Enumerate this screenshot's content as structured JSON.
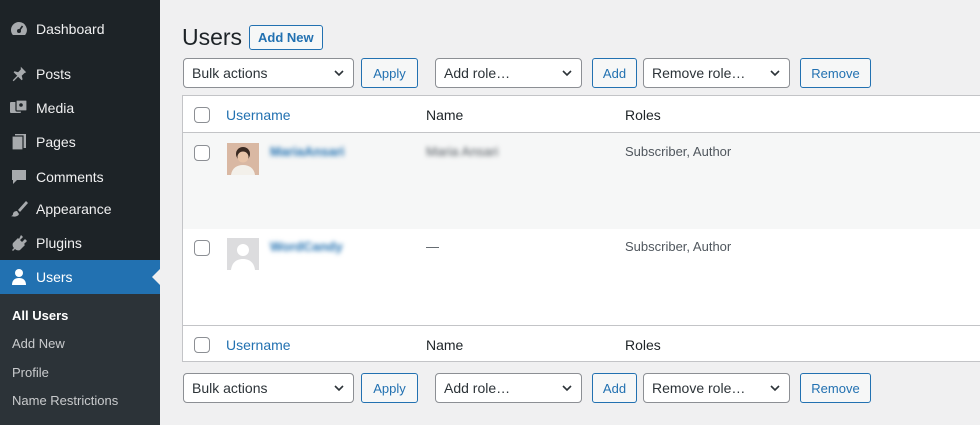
{
  "sidebar": {
    "items": [
      {
        "label": "Dashboard",
        "icon": "dashboard-icon"
      },
      {
        "label": "Posts",
        "icon": "pin-icon"
      },
      {
        "label": "Media",
        "icon": "media-icon"
      },
      {
        "label": "Pages",
        "icon": "pages-icon"
      },
      {
        "label": "Comments",
        "icon": "comment-icon"
      },
      {
        "label": "Appearance",
        "icon": "brush-icon"
      },
      {
        "label": "Plugins",
        "icon": "plugin-icon"
      },
      {
        "label": "Users",
        "icon": "user-icon"
      }
    ],
    "submenu": [
      "All Users",
      "Add New",
      "Profile",
      "Name Restrictions"
    ],
    "accent": "#2271b1"
  },
  "header": {
    "title": "Users",
    "add_new": "Add New"
  },
  "toolbar": {
    "bulk_actions": "Bulk actions",
    "apply": "Apply",
    "add_role": "Add role…",
    "add": "Add",
    "remove_role": "Remove role…",
    "remove": "Remove"
  },
  "table": {
    "columns": [
      "Username",
      "Name",
      "Roles"
    ],
    "rows": [
      {
        "username": "MariaAnsari",
        "name": "Maria Ansari",
        "roles": "Subscriber, Author"
      },
      {
        "username": "WordCandy",
        "name": "—",
        "roles": "Subscriber, Author"
      }
    ]
  }
}
